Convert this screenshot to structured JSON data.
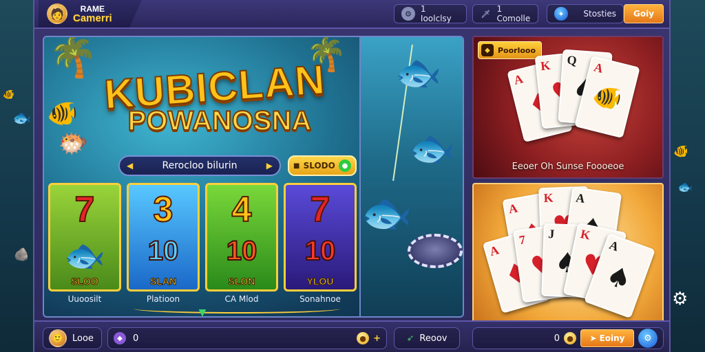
{
  "brand": {
    "line1": "RAME",
    "line2": "Camerri"
  },
  "topbar": {
    "pill1": {
      "icon": "settings-icon",
      "label": "1  Ioolclsy"
    },
    "pill2": {
      "icon": "sword-icon",
      "label": "1  Comolle"
    },
    "pill3": {
      "icon": "globe-icon",
      "label": "Stosties"
    },
    "action_button": "Goiy"
  },
  "main": {
    "title_line1": "KUBICLAN",
    "title_line2": "POWANOSNA",
    "search_placeholder": "Rerocloo bilurin",
    "gold_pill_label": "SLODO",
    "tiles": [
      {
        "symbol": "7",
        "number": "",
        "caption": "SLOO",
        "label": "Uuoosilt",
        "icon": "fish-icon"
      },
      {
        "symbol": "3",
        "number": "10",
        "caption": "SLAN",
        "label": "Platioon",
        "icon": ""
      },
      {
        "symbol": "4",
        "number": "10",
        "caption": "SLON",
        "label": "CA Mlod",
        "icon": ""
      },
      {
        "symbol": "7",
        "number": "10",
        "caption": "YLOU",
        "label": "Sonahnoe",
        "icon": ""
      }
    ]
  },
  "right": {
    "top_badge": "Poorlooo",
    "top_caption": "Eeoer Oh Sunse Foooeoe"
  },
  "bottombar": {
    "profile_label": "Looe",
    "balance_value": "0",
    "balance_add": "+",
    "item_label": "Reoov",
    "coin_value": "0",
    "deposit_button": "Eoiny"
  },
  "colors": {
    "frame": "#2c2a5c",
    "accent_gold": "#ffcf3a",
    "accent_orange": "#e4781a"
  }
}
